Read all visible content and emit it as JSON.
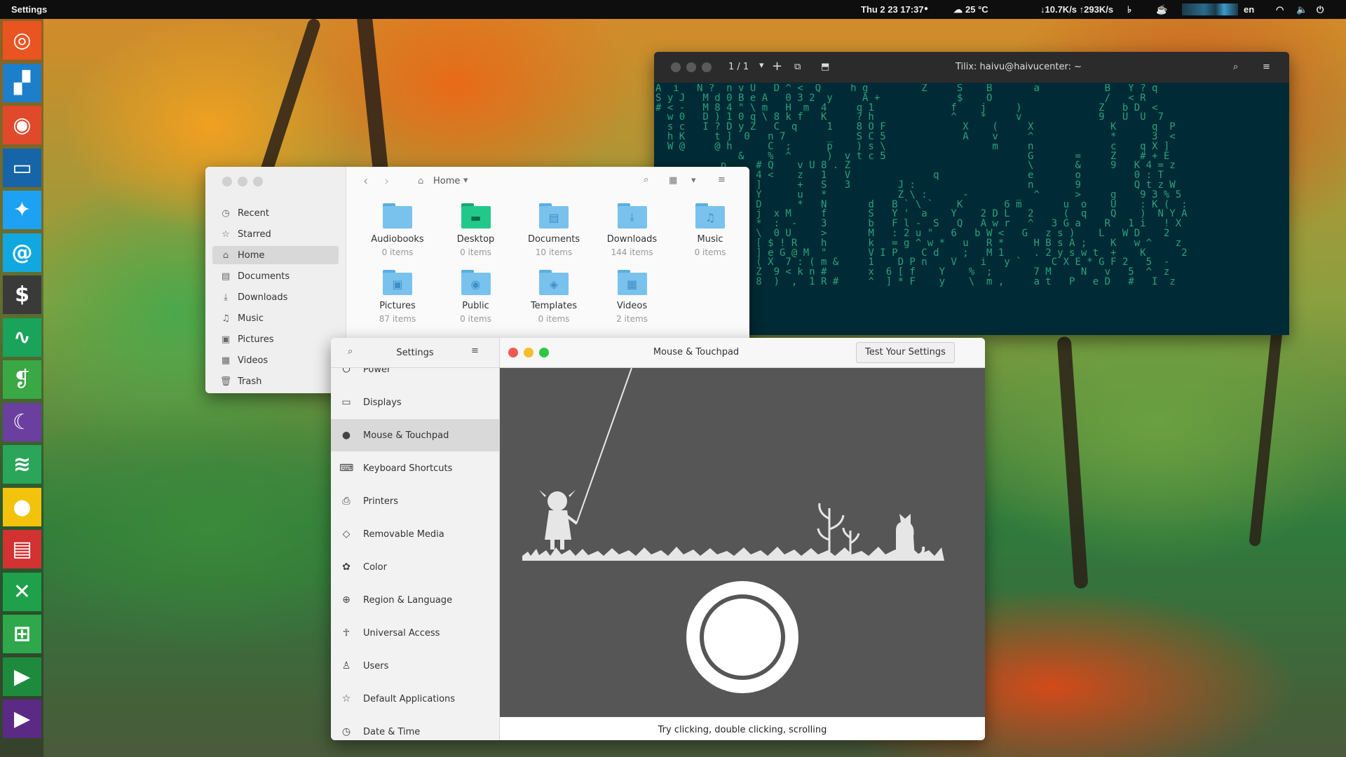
{
  "topbar": {
    "app_name": "Settings",
    "datetime": "Thu 2 23  17:37",
    "weather": "25 °C",
    "network": "↓10.7K/s ↑293K/s",
    "language": "en"
  },
  "dock": {
    "items": [
      {
        "name": "ubuntu-icon",
        "color": "#e95420",
        "glyph": "◎"
      },
      {
        "name": "apps-grid-icon",
        "color": "#1d7fc9",
        "glyph": "▞"
      },
      {
        "name": "chrome-icon",
        "color": "#e04a2a",
        "glyph": "◉"
      },
      {
        "name": "files-icon",
        "color": "#1565a8",
        "glyph": "▭"
      },
      {
        "name": "twitter-icon",
        "color": "#1da1f2",
        "glyph": "✦"
      },
      {
        "name": "email-icon",
        "color": "#11a8e0",
        "glyph": "@"
      },
      {
        "name": "terminal-icon",
        "color": "#3a3a3a",
        "glyph": "$"
      },
      {
        "name": "system-monitor-icon",
        "color": "#1aa35a",
        "glyph": "∿"
      },
      {
        "name": "evernote-icon",
        "color": "#39a845",
        "glyph": "❡"
      },
      {
        "name": "thunderbird-icon",
        "color": "#6b3fa0",
        "glyph": "☾"
      },
      {
        "name": "rss-icon",
        "color": "#2aa55a",
        "glyph": "≋"
      },
      {
        "name": "chat-icon",
        "color": "#f2c20c",
        "glyph": "●"
      },
      {
        "name": "news-icon",
        "color": "#d23232",
        "glyph": "▤"
      },
      {
        "name": "crossover-icon",
        "color": "#1fa04a",
        "glyph": "✕"
      },
      {
        "name": "games-icon",
        "color": "#2ea84a",
        "glyph": "⊞"
      },
      {
        "name": "video-editor-icon",
        "color": "#1e8a3e",
        "glyph": "▶"
      },
      {
        "name": "media-player-icon",
        "color": "#5b2a84",
        "glyph": "▶"
      }
    ]
  },
  "terminal": {
    "title": "Tilix: haivu@haivucenter: ~",
    "session": "1 / 1",
    "lines": [
      "A  i   N ?  n v U   D ^ <  Q     h g         Z     S    B       a           B   Y ? q",
      "S y J   M d 0 B e A   0 3 2  y     A +             $    O                   /   < R",
      "# < -   M 8 4 \" \\ m   H  m  4     q 1             f    j     )             Z   b D  <",
      "  w 0   D ) 1 0 q \\ 8 k f   K     ? h             ^    *     v             9   U  U  7",
      "  s c   I ? D y Z   C  q     1    8 O F             X    (     X             K      q  P",
      "  h K     t ]  0   n 7       _    S C 5             A    v     ^             *      3  <",
      "  W @     @ h      C  ;      p    ) s \\                  m     n             c    q X ]",
      "              &    %  ^      )  v t c 5                        G       =     Z    # + E",
      "           p     # Q    v U 8 . Z                              \\       &     9   K 4 = z",
      "           )     4 <    z   1   V              q               e       o         0 : T",
      "           `     ]      +   S   3        J :                   n       9         Q t z W",
      "           >     Y      u   *            Z \\ :      -        _  ^      >     g    9 3 % 5",
      "           Y     D      *   N       d   B ` \\ `    K       6 m       u  o    U    : K (  :",
      "           X     j  x M     f       S   Y '  a    Y    2 D L   2     (  q    Q    )  N Y A",
      "           !     *  :  -    3       b   F l -  S   Q   A w r   ^   3 G a    R   1 i   ! X",
      "           %     \\  0 U     >       M   : 2 u \"   6   b W <   G   z s )    L   W D    2",
      "           [     [ $ ! R    h       k   = g ^ w *   u   R *     H B s A ;    K   w ^    z",
      "           (     ] e G @ M  \"       V I P    C d    ;   M 1     . 2 y s w t  +    K      2",
      "           %     ( X  7 : ( m &     1    D P n    V    i   y `     C X E * G F 2   5  -",
      "           \"     Z  9 < k n #       x  6 [ f    Y    %  ;       7 M     N   v   5  ^  z",
      "           1     8  )  ,  1 R #     ^  ] * F    y    \\  m ,     a t   P   e D   #   I  z"
    ]
  },
  "files": {
    "location": "Home",
    "sidebar": [
      "Recent",
      "Starred",
      "Home",
      "Documents",
      "Downloads",
      "Music",
      "Pictures",
      "Videos",
      "Trash"
    ],
    "sidebar_icons": [
      "◷",
      "☆",
      "⌂",
      "▤",
      "⤓",
      "♫",
      "▣",
      "▦",
      "🗑"
    ],
    "folders": [
      {
        "name": "Audiobooks",
        "count": "0 items",
        "glyph": ""
      },
      {
        "name": "Desktop",
        "count": "0 items",
        "glyph": ""
      },
      {
        "name": "Documents",
        "count": "10 items",
        "glyph": "▤"
      },
      {
        "name": "Downloads",
        "count": "144 items",
        "glyph": "⤓"
      },
      {
        "name": "Music",
        "count": "0 items",
        "glyph": "♫"
      },
      {
        "name": "Pictures",
        "count": "87 items",
        "glyph": "▣"
      },
      {
        "name": "Public",
        "count": "0 items",
        "glyph": "◉"
      },
      {
        "name": "Templates",
        "count": "0 items",
        "glyph": "◈"
      },
      {
        "name": "Videos",
        "count": "2 items",
        "glyph": "▦"
      }
    ]
  },
  "settings": {
    "sidebar_title": "Settings",
    "panel_title": "Mouse & Touchpad",
    "test_button": "Test Your Settings",
    "hint": "Try clicking, double clicking, scrolling",
    "items": [
      {
        "label": "Power",
        "icon": "⏻"
      },
      {
        "label": "Displays",
        "icon": "▭"
      },
      {
        "label": "Mouse & Touchpad",
        "icon": "●"
      },
      {
        "label": "Keyboard Shortcuts",
        "icon": "⌨"
      },
      {
        "label": "Printers",
        "icon": "⎙"
      },
      {
        "label": "Removable Media",
        "icon": "◇"
      },
      {
        "label": "Color",
        "icon": "✿"
      },
      {
        "label": "Region & Language",
        "icon": "⊕"
      },
      {
        "label": "Universal Access",
        "icon": "☥"
      },
      {
        "label": "Users",
        "icon": "♙"
      },
      {
        "label": "Default Applications",
        "icon": "☆"
      },
      {
        "label": "Date & Time",
        "icon": "◷"
      }
    ]
  }
}
